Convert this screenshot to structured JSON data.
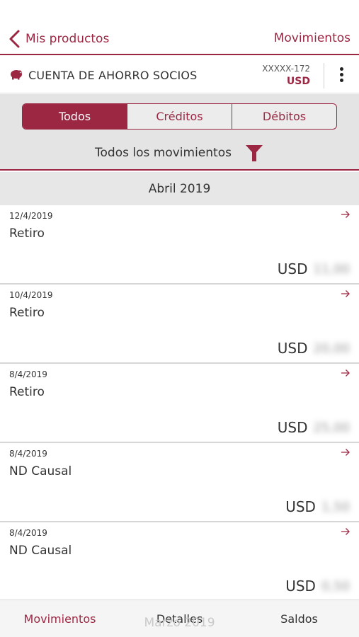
{
  "header": {
    "back_label": "Mis productos",
    "title": "Movimientos"
  },
  "account": {
    "name": "CUENTA DE AHORRO SOCIOS",
    "number": "XXXXX-172",
    "currency": "USD"
  },
  "filters": {
    "tabs": [
      {
        "label": "Todos",
        "active": true
      },
      {
        "label": "Créditos",
        "active": false
      },
      {
        "label": "Débitos",
        "active": false
      }
    ],
    "filter_label": "Todos los movimientos"
  },
  "month_header": "Abril 2019",
  "transactions": [
    {
      "date": "12/4/2019",
      "description": "Retiro",
      "currency": "USD",
      "amount": "11,00"
    },
    {
      "date": "10/4/2019",
      "description": "Retiro",
      "currency": "USD",
      "amount": "20,00"
    },
    {
      "date": "8/4/2019",
      "description": "Retiro",
      "currency": "USD",
      "amount": "25,00"
    },
    {
      "date": "8/4/2019",
      "description": "ND Causal",
      "currency": "USD",
      "amount": "1,50"
    },
    {
      "date": "8/4/2019",
      "description": "ND Causal",
      "currency": "USD",
      "amount": "0,50"
    }
  ],
  "next_month_header": "Marzo 2019",
  "bottom_tabs": [
    {
      "label": "Movimientos",
      "active": true
    },
    {
      "label": "Detalles",
      "active": false
    },
    {
      "label": "Saldos",
      "active": false
    }
  ],
  "colors": {
    "accent": "#9b2743",
    "filter_bg": "#e4e4e4",
    "month_bg": "#e7e7e7"
  }
}
